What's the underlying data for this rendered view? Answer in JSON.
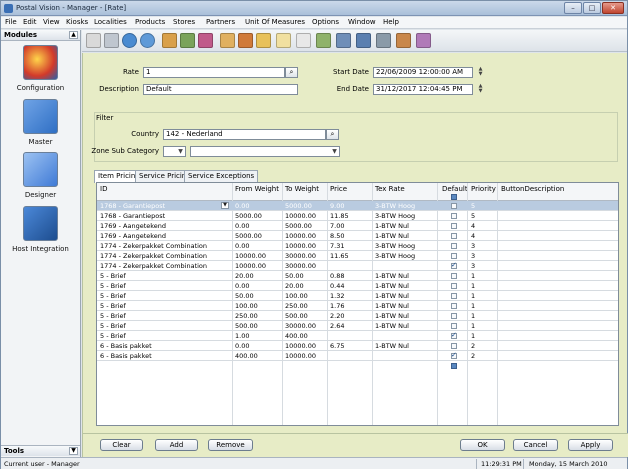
{
  "window": {
    "title": "Postal Vision - Manager - [Rate]",
    "controls": {
      "minimize": "–",
      "maximize": "□",
      "close": "✕"
    }
  },
  "menu": [
    "File",
    "Edit",
    "View",
    "Kiosks",
    "Localities",
    "Products",
    "Stores",
    "Partners",
    "Unit Of Measures",
    "Options",
    "Window",
    "Help"
  ],
  "sidebar": {
    "header": "Modules",
    "modules": [
      {
        "label": "Configuration",
        "icon": "configuration-icon",
        "color": "#d23a2a"
      },
      {
        "label": "Master",
        "icon": "master-icon",
        "color": "#2f6fc4"
      },
      {
        "label": "Designer",
        "icon": "designer-icon",
        "color": "#3f7ad6"
      },
      {
        "label": "Host Integration",
        "icon": "host-integration-icon",
        "color": "#2a64b0"
      }
    ],
    "tools": "Tools"
  },
  "toolbar": {
    "icons": [
      "pins-icon",
      "glasses-icon",
      "globe-icon",
      "globe2-icon",
      "boxes-icon",
      "people-icon",
      "kiosk-icon",
      "calendar-icon",
      "box-icon",
      "arrow-icon",
      "percent-icon",
      "barcode-icon",
      "scale-icon",
      "device-icon",
      "screen-icon",
      "stack-icon",
      "person-icon",
      "tree-icon"
    ]
  },
  "form": {
    "rate_label": "Rate",
    "rate_value": "1",
    "description_label": "Description",
    "description_value": "Default",
    "start_date_label": "Start Date",
    "start_date_value": "22/06/2009 12:00:00 AM",
    "end_date_label": "End Date",
    "end_date_value": "31/12/2017 12:04:45 PM"
  },
  "filter": {
    "title": "Filter",
    "country_label": "Country",
    "country_value": "142 - Nederland",
    "zone_label": "Zone Sub Category",
    "zone_value": "",
    "zone_value2": ""
  },
  "tabs": [
    "Item Pricing",
    "Service Pricing",
    "Service Exceptions"
  ],
  "grid": {
    "columns": [
      "ID",
      "From Weight",
      "To Weight",
      "Price",
      "Tex Rate",
      "Default",
      "Priority",
      "ButtonDescription"
    ],
    "rows": [
      {
        "id": "1768 - Garantiepost",
        "from": "0.00",
        "to": "5000.00",
        "price": "9.00",
        "tax": "3-BTW Hoog",
        "default": false,
        "priority": "5",
        "selected": true
      },
      {
        "id": "1768 - Garantiepost",
        "from": "5000.00",
        "to": "10000.00",
        "price": "11.85",
        "tax": "3-BTW Hoog",
        "default": false,
        "priority": "5"
      },
      {
        "id": "1769 - Aangetekend",
        "from": "0.00",
        "to": "5000.00",
        "price": "7.00",
        "tax": "1-BTW Nul",
        "default": false,
        "priority": "4"
      },
      {
        "id": "1769 - Aangetekend",
        "from": "5000.00",
        "to": "10000.00",
        "price": "8.50",
        "tax": "1-BTW Nul",
        "default": false,
        "priority": "4"
      },
      {
        "id": "1774 - Zekerpakket Combination",
        "from": "0.00",
        "to": "10000.00",
        "price": "7.31",
        "tax": "3-BTW Hoog",
        "default": false,
        "priority": "3"
      },
      {
        "id": "1774 - Zekerpakket Combination",
        "from": "10000.00",
        "to": "30000.00",
        "price": "11.65",
        "tax": "3-BTW Hoog",
        "default": false,
        "priority": "3"
      },
      {
        "id": "1774 - Zekerpakket Combination",
        "from": "10000.00",
        "to": "30000.00",
        "price": "",
        "tax": "",
        "default": true,
        "priority": "3"
      },
      {
        "id": "5 - Brief",
        "from": "20.00",
        "to": "50.00",
        "price": "0.88",
        "tax": "1-BTW Nul",
        "default": false,
        "priority": "1"
      },
      {
        "id": "5 - Brief",
        "from": "0.00",
        "to": "20.00",
        "price": "0.44",
        "tax": "1-BTW Nul",
        "default": false,
        "priority": "1"
      },
      {
        "id": "5 - Brief",
        "from": "50.00",
        "to": "100.00",
        "price": "1.32",
        "tax": "1-BTW Nul",
        "default": false,
        "priority": "1"
      },
      {
        "id": "5 - Brief",
        "from": "100.00",
        "to": "250.00",
        "price": "1.76",
        "tax": "1-BTW Nul",
        "default": false,
        "priority": "1"
      },
      {
        "id": "5 - Brief",
        "from": "250.00",
        "to": "500.00",
        "price": "2.20",
        "tax": "1-BTW Nul",
        "default": false,
        "priority": "1"
      },
      {
        "id": "5 - Brief",
        "from": "500.00",
        "to": "30000.00",
        "price": "2.64",
        "tax": "1-BTW Nul",
        "default": false,
        "priority": "1"
      },
      {
        "id": "5 - Brief",
        "from": "1.00",
        "to": "400.00",
        "price": "",
        "tax": "",
        "default": true,
        "priority": "1"
      },
      {
        "id": "6 - Basis pakket",
        "from": "0.00",
        "to": "10000.00",
        "price": "6.75",
        "tax": "1-BTW Nul",
        "default": false,
        "priority": "2"
      },
      {
        "id": "6 - Basis pakket",
        "from": "400.00",
        "to": "10000.00",
        "price": "",
        "tax": "",
        "default": true,
        "priority": "2"
      }
    ]
  },
  "buttons": {
    "clear": "Clear",
    "add": "Add",
    "remove": "Remove",
    "ok": "OK",
    "cancel": "Cancel",
    "apply": "Apply"
  },
  "status": {
    "user": "Current user - Manager",
    "time": "11:29:31 PM",
    "date": "Monday, 15 March 2010"
  }
}
